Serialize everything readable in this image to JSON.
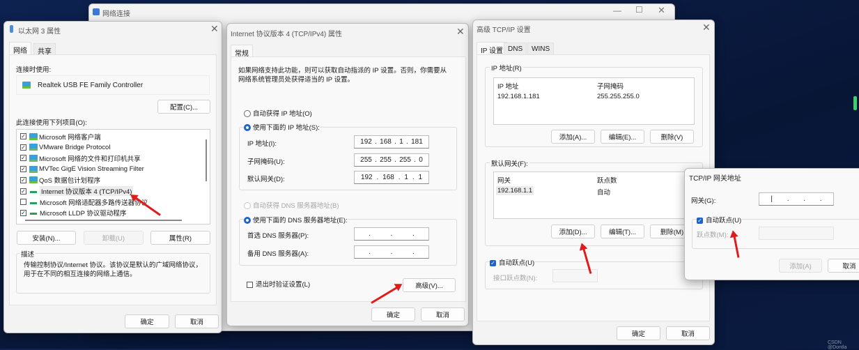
{
  "background_window": {
    "title": "网络连接"
  },
  "ethernet_dialog": {
    "title": "以太网 3 属性",
    "tabs": [
      "网络",
      "共享"
    ],
    "connect_using_label": "连接时使用:",
    "adapter": "Realtek USB FE Family Controller",
    "configure_button": "配置(C)...",
    "items_label": "此连接使用下列项目(O):",
    "items": [
      {
        "label": "Microsoft 网络客户端",
        "checked": true,
        "icon": "network-icon"
      },
      {
        "label": "VMware Bridge Protocol",
        "checked": true,
        "icon": "network-icon"
      },
      {
        "label": "Microsoft 网络的文件和打印机共享",
        "checked": true,
        "icon": "network-icon"
      },
      {
        "label": "MVTec GigE Vision Streaming Filter",
        "checked": true,
        "icon": "network-icon"
      },
      {
        "label": "QoS 数据包计划程序",
        "checked": true,
        "icon": "network-icon"
      },
      {
        "label": "Internet 协议版本 4 (TCP/IPv4)",
        "checked": true,
        "icon": "protocol-icon"
      },
      {
        "label": "Microsoft 网络适配器多路传送器协议",
        "checked": false,
        "icon": "protocol-icon"
      },
      {
        "label": "Microsoft LLDP 协议驱动程序",
        "checked": true,
        "icon": "protocol-icon"
      }
    ],
    "install_button": "安装(N)...",
    "uninstall_button": "卸载(U)",
    "properties_button": "属性(R)",
    "description_label": "描述",
    "description_text": "传输控制协议/Internet 协议。该协议是默认的广域网络协议，用于在不同的相互连接的网络上通信。",
    "ok_button": "确定",
    "cancel_button": "取消"
  },
  "ipv4_dialog": {
    "title": "Internet 协议版本 4 (TCP/IPv4) 属性",
    "tab": "常规",
    "intro": "如果网络支持此功能，则可以获取自动指派的 IP 设置。否则，你需要从网络系统管理员处获得适当的 IP 设置。",
    "auto_ip_radio": "自动获得 IP 地址(O)",
    "manual_ip_radio": "使用下面的 IP 地址(S):",
    "ip_label": "IP 地址(I):",
    "ip_octets": [
      "192",
      "168",
      "1",
      "181"
    ],
    "mask_label": "子网掩码(U):",
    "mask_octets": [
      "255",
      "255",
      "255",
      "0"
    ],
    "gateway_label": "默认网关(D):",
    "gateway_octets": [
      "192",
      "168",
      "1",
      "1"
    ],
    "auto_dns_radio": "自动获得 DNS 服务器地址(B)",
    "manual_dns_radio": "使用下面的 DNS 服务器地址(E):",
    "preferred_dns_label": "首选 DNS 服务器(P):",
    "alternate_dns_label": "备用 DNS 服务器(A):",
    "validate_checkbox": "退出时验证设置(L)",
    "advanced_button": "高级(V)...",
    "ok_button": "确定",
    "cancel_button": "取消"
  },
  "advanced_dialog": {
    "title": "高级 TCP/IP 设置",
    "tabs": [
      "IP 设置",
      "DNS",
      "WINS"
    ],
    "ip_group_label": "IP 地址(R)",
    "ip_columns": [
      "IP 地址",
      "子网掩码"
    ],
    "ip_rows": [
      [
        "192.168.1.181",
        "255.255.255.0"
      ]
    ],
    "ip_add": "添加(A)...",
    "ip_edit": "编辑(E)...",
    "ip_remove": "删除(V)",
    "gw_group_label": "默认网关(F):",
    "gw_columns": [
      "网关",
      "跃点数"
    ],
    "gw_rows": [
      [
        "192.168.1.1",
        "自动"
      ]
    ],
    "gw_add": "添加(D)...",
    "gw_edit": "编辑(T)...",
    "gw_remove": "删除(M)",
    "auto_metric_checkbox": "自动跃点(U)",
    "interface_metric_label": "接口跃点数(N):",
    "ok_button": "确定",
    "cancel_button": "取消"
  },
  "gateway_dialog": {
    "title": "TCP/IP 网关地址",
    "gateway_label": "网关(G):",
    "auto_metric_checkbox": "自动跃点(U)",
    "metric_label": "跃点数(M):",
    "add_button": "添加(A)",
    "cancel_button": "取消"
  },
  "watermark": "CSDN @Dontla",
  "colors": {
    "accent": "#1d64c6",
    "arrow": "#e01b1b"
  }
}
